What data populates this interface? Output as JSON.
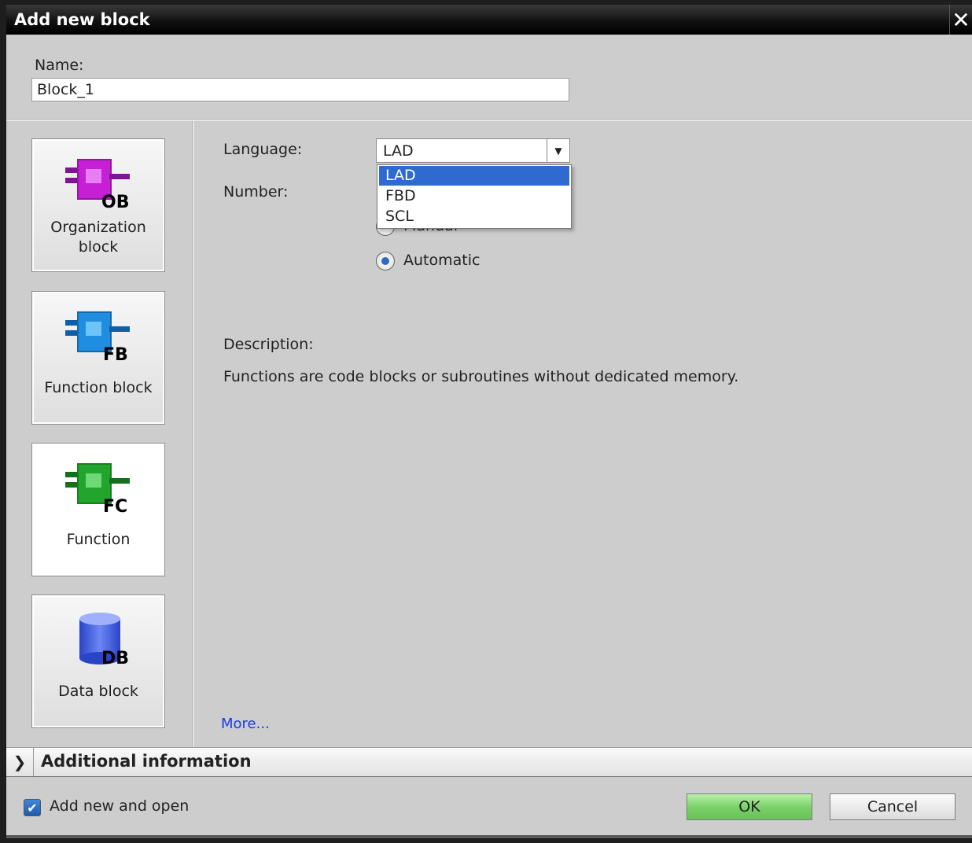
{
  "window": {
    "title": "Add new block",
    "close_icon": "close-icon"
  },
  "name_field": {
    "label": "Name:",
    "value": "Block_1"
  },
  "block_types": [
    {
      "label": "Organization block",
      "icon": "ob-icon",
      "tag": "OB",
      "color": "#c61fd6",
      "selected": false
    },
    {
      "label": "Function block",
      "icon": "fb-icon",
      "tag": "FB",
      "color": "#1f8ee0",
      "selected": false
    },
    {
      "label": "Function",
      "icon": "fc-icon",
      "tag": "FC",
      "color": "#22a52c",
      "selected": true
    },
    {
      "label": "Data block",
      "icon": "db-icon",
      "tag": "DB",
      "color": "#3f5fe0",
      "selected": false
    }
  ],
  "language": {
    "label": "Language:",
    "value": "LAD",
    "options": [
      "LAD",
      "FBD",
      "SCL"
    ],
    "highlighted": "LAD"
  },
  "number": {
    "label": "Number:",
    "manual_label": "Manual",
    "auto_label": "Automatic",
    "selected": "Automatic"
  },
  "description": {
    "label": "Description:",
    "text": "Functions are code blocks or subroutines without dedicated memory."
  },
  "more_link": "More...",
  "additional_info": {
    "label": "Additional  information"
  },
  "footer": {
    "add_new_and_open_label": "Add new and open",
    "add_new_and_open_checked": true,
    "ok_label": "OK",
    "cancel_label": "Cancel"
  }
}
